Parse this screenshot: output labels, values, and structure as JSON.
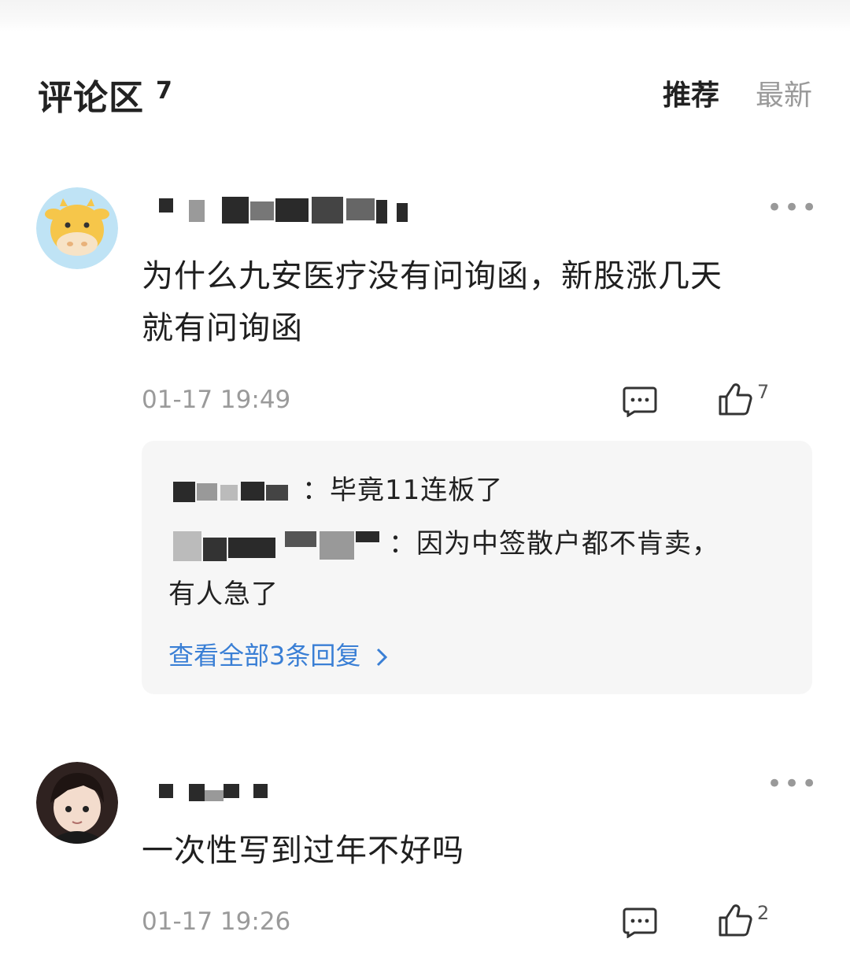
{
  "header": {
    "title": "评论区",
    "count": "7",
    "tab_recommended": "推荐",
    "tab_latest": "最新"
  },
  "comments": [
    {
      "avatar_icon": "cow-avatar-icon",
      "username": "",
      "content_line1": "为什么九安医疗没有问询函，新股涨几天",
      "content_line2": "就有问询函",
      "time": "01-17 19:49",
      "likes": "7",
      "replies": [
        {
          "username": "",
          "text": "：毕竟11连板了"
        },
        {
          "username": "",
          "text": "：因为中签散户都不肯卖，"
        }
      ],
      "reply_continuation": "有人急了",
      "view_all": "查看全部3条回复"
    },
    {
      "avatar_icon": "cartoon-person-avatar-icon",
      "username": "",
      "content_line1": "一次性写到过年不好吗",
      "time": "01-17 19:26",
      "likes": "2"
    }
  ],
  "colors": {
    "accent_link": "#3a7fd5",
    "text_primary": "#1f1f1f",
    "text_secondary": "#9a9a9a",
    "reply_bg": "#f6f6f6"
  }
}
